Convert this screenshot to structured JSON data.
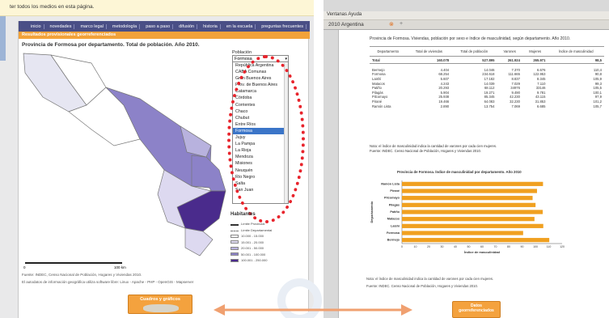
{
  "left": {
    "top_bar_text": "ter todos los medios en esta página.",
    "nav": [
      "inicio",
      "novedades",
      "marco legal",
      "metodología",
      "paso a paso",
      "difusión",
      "historia",
      "en la escuela",
      "preguntas frecuentes"
    ],
    "orange_title": "Resultados provisionales georreferenciados",
    "map_title": "Provincia de Formosa por departamento. Total de población. Año 2010.",
    "select": {
      "label": "Población",
      "current": "Formosa",
      "options": [
        "República Argentina",
        "CABA Comunas",
        "Gran Buenos Aires",
        "Prov. de Buenos Aires",
        "Catamarca",
        "Córdoba",
        "Corrientes",
        "Chaco",
        "Chubut",
        "Entre Ríos",
        "Formosa",
        "Jujuy",
        "La Pampa",
        "La Rioja",
        "Mendoza",
        "Misiones",
        "Neuquén",
        "Río Negro",
        "Salta",
        "San Juan"
      ],
      "selected": "Formosa"
    },
    "legend": {
      "title": "Habitantes",
      "rows": [
        "Límite Provincial",
        "Límite Departamental",
        "10.000 - 15.000",
        "15.001 - 20.000",
        "20.001 - 50.000",
        "50.001 - 100.000",
        "100.001 - 250.000"
      ]
    },
    "scale": {
      "left": "0",
      "right": "100 km"
    },
    "source_1": "Fuente: INDEC, Censo Nacional de Población, Hogares y Viviendas 2010.",
    "source_2": "El autodatos de información geográfica utiliza software libre: Linux - Apache - PHP - OpenGIS - Mapserver",
    "button": "Cuadros y gráficos"
  },
  "right": {
    "menubar": "Ventanas  Ayuda",
    "tab": "2010 Argentina",
    "title": "Provincia de Formosa. Viviendas, población por sexo e índice de masculinidad, según departamento. Año 2010.",
    "table": {
      "headers": [
        "Departamento",
        "Total de viviendas",
        "Total de población",
        "Varones",
        "Mujeres",
        "Índice de masculinidad"
      ],
      "total": [
        "Total",
        "160.078",
        "527.895",
        "261.924",
        "265.971",
        "98,5"
      ],
      "rows": [
        [
          "Bermejo",
          "4.404",
          "14.046",
          "7.370",
          "6.676",
          "110,4"
        ],
        [
          "Formosa",
          "68.254",
          "234.618",
          "111.665",
          "122.953",
          "90,8"
        ],
        [
          "Laishí",
          "5.607",
          "17.182",
          "8.837",
          "8.345",
          "105,9"
        ],
        [
          "Matacos",
          "4.243",
          "14.039",
          "7.029",
          "7.110",
          "99,3"
        ],
        [
          "Patiño",
          "20.293",
          "68.112",
          "34976",
          "33146",
          "105,5"
        ],
        [
          "Pilagás",
          "5.904",
          "19.271",
          "9.490",
          "9.781",
          "100,1"
        ],
        [
          "Pilcomayo",
          "25.938",
          "85.345",
          "42.230",
          "43.115",
          "97,9"
        ],
        [
          "Pirané",
          "19.466",
          "64.083",
          "32.230",
          "31.853",
          "101,2"
        ],
        [
          "Ramón Lista",
          "2.890",
          "13.754",
          "7.069",
          "6.685",
          "105,7"
        ]
      ]
    },
    "note_1": "Nota: el índice de masculinidad indica la cantidad de varones por cada cien mujeres.",
    "note_2": "Fuente: INDEC. Censo Nacional de Población, Hogares y Viviendas 2010.",
    "note_3": "Nota: el índice de masculinidad indica la cantidad de varones por cada cien mujeres.",
    "note_4": "Fuente: INDEC. Censo Nacional de Población, Hogares y Viviendas 2010.",
    "button": "Datos georreferenciados"
  },
  "chart_data": {
    "type": "bar",
    "orientation": "horizontal",
    "title": "Provincia de Formosa. Índice de masculinidad por departamento. Año 2010",
    "ylabel": "Departamento",
    "xlabel": "Índice de masculinidad",
    "categories": [
      "Ramón Lista",
      "Pirané",
      "Pilcomayo",
      "Pilagás",
      "Patiño",
      "Matacos",
      "Laishí",
      "Formosa",
      "Bermejo"
    ],
    "values": [
      105.7,
      101.2,
      97.9,
      100.1,
      105.5,
      99.3,
      105.9,
      90.8,
      110.4
    ],
    "xticks": [
      "0",
      "10",
      "20",
      "30",
      "40",
      "50",
      "60",
      "70",
      "80",
      "90",
      "100",
      "110",
      "120"
    ],
    "xlim": [
      0,
      120
    ],
    "bar_color": "#f0a020",
    "grid": false
  },
  "colors": {
    "nav": "#4a4f86",
    "orange": "#f2a23a",
    "highlight": "#e8242c",
    "arrow": "#f0a070"
  }
}
